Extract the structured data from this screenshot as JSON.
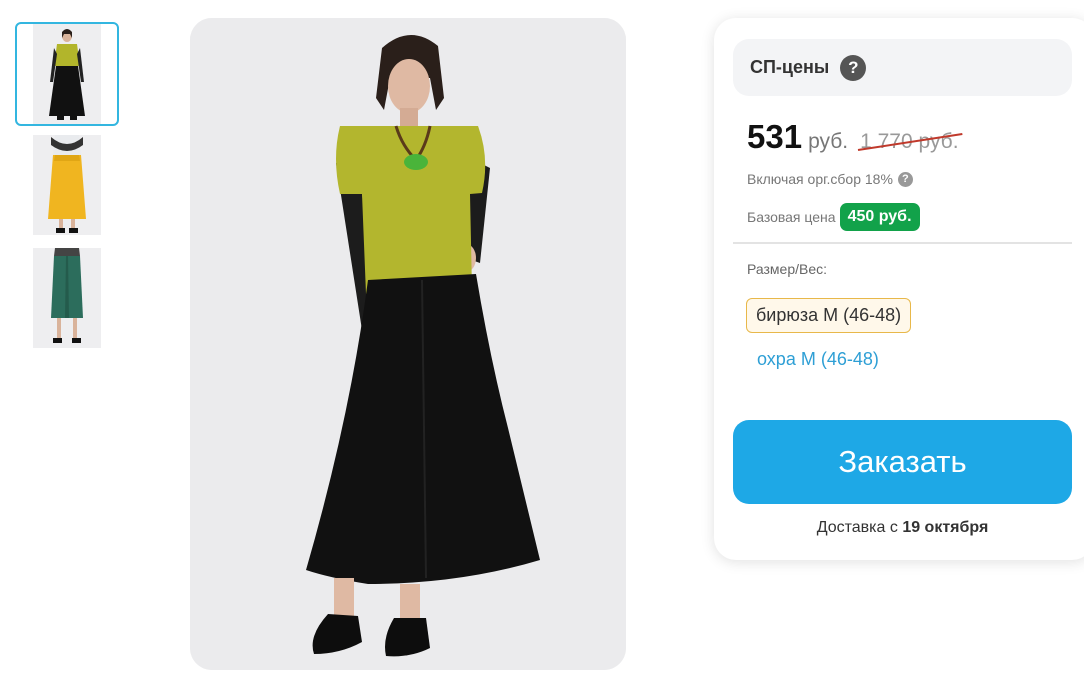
{
  "gallery": {
    "thumbnails": [
      {
        "alt": "outfit-olive-top-black-skirt",
        "selected": true
      },
      {
        "alt": "outfit-yellow-skirt",
        "selected": false
      },
      {
        "alt": "outfit-teal-skirt",
        "selected": false
      }
    ]
  },
  "card": {
    "sp_label": "СП-цены",
    "help_icon": "?",
    "price": "531",
    "currency": "руб.",
    "old_price": "1 770 руб.",
    "fee_text": "Включая орг.сбор 18%",
    "base_label": "Базовая цена",
    "base_price": "450 руб.",
    "size_label": "Размер/Вес:",
    "sizes": [
      {
        "label": "бирюза M (46-48)",
        "selected": true
      },
      {
        "label": "охра M (46-48)",
        "selected": false
      }
    ],
    "order_button": "Заказать",
    "delivery_prefix": "Доставка с",
    "delivery_date": "19 октября"
  },
  "colors": {
    "accent": "#1ea8e6",
    "badge_green": "#12a24a",
    "thumb_border": "#33b6e0",
    "strike_red": "#c0392b"
  }
}
